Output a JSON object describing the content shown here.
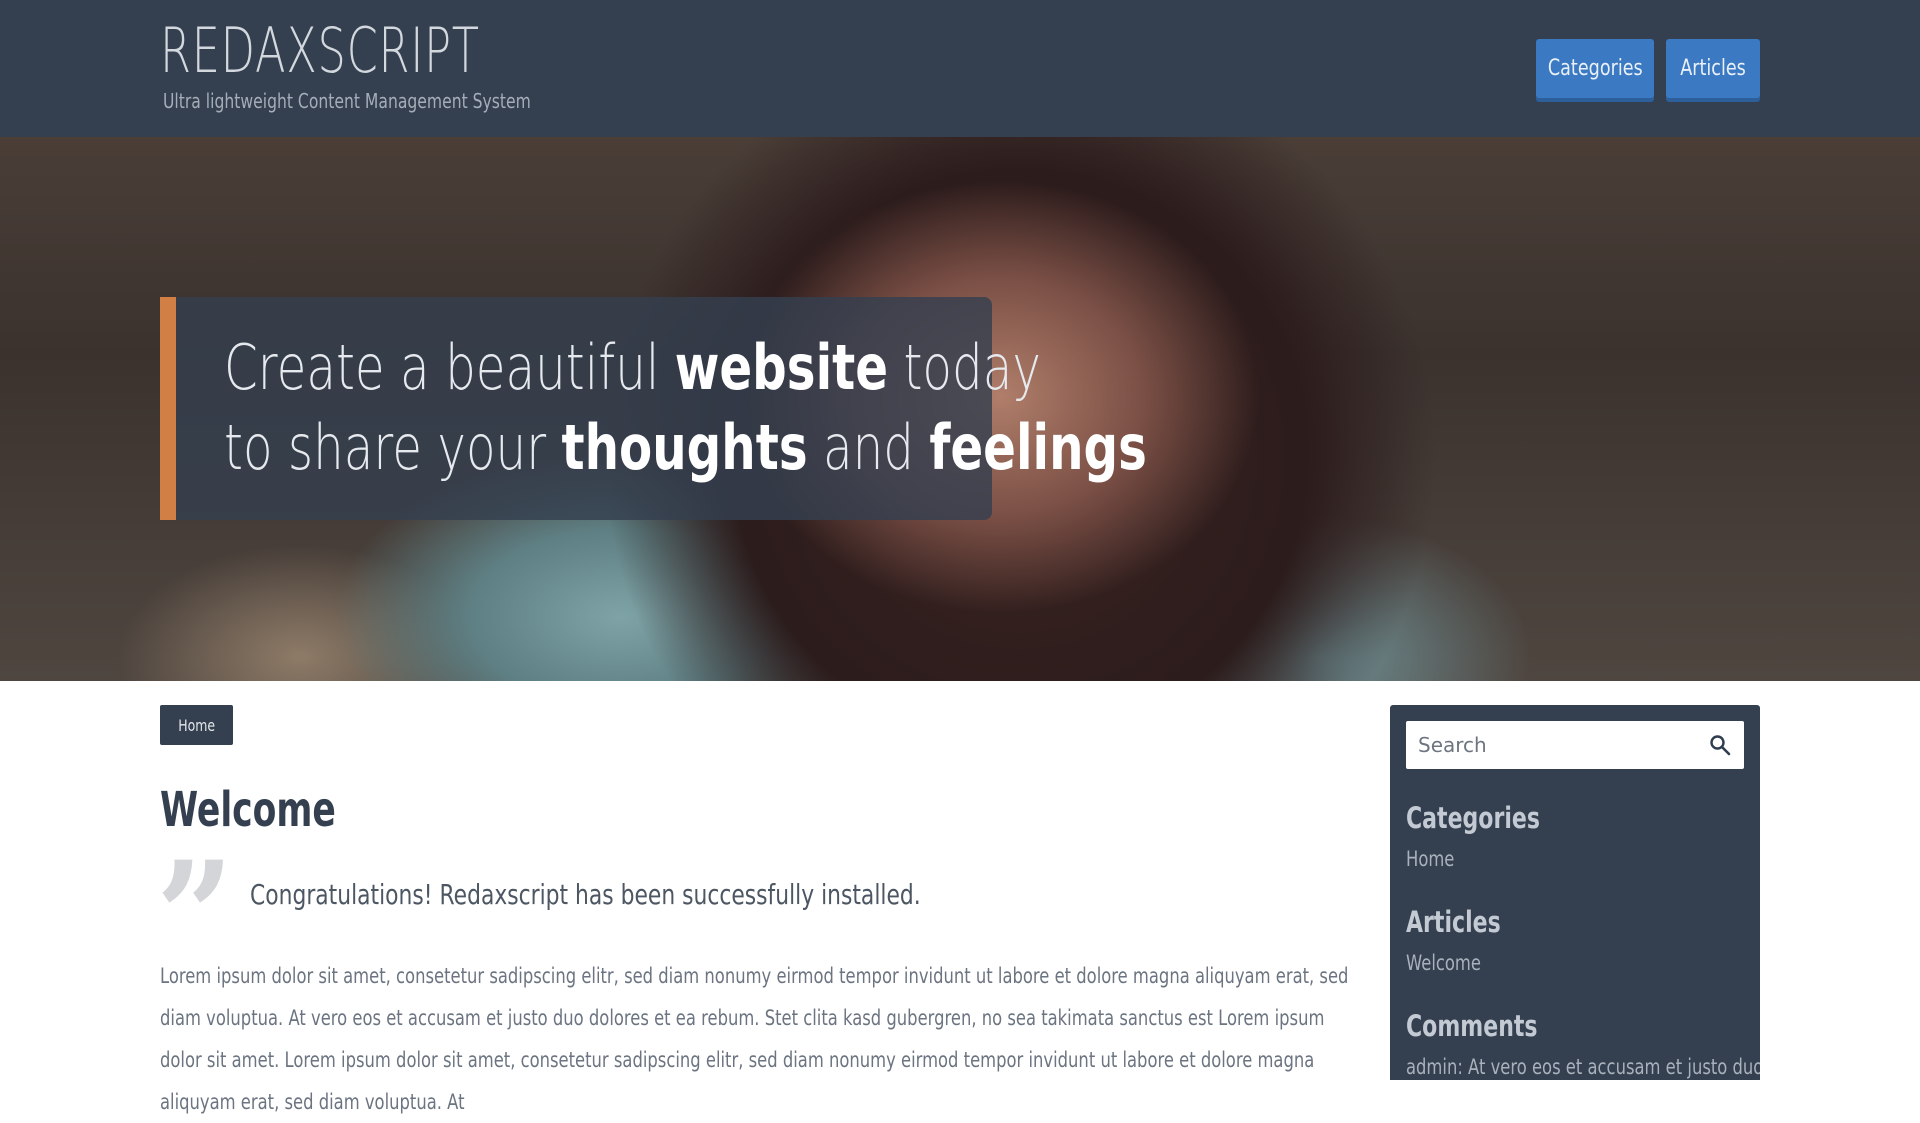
{
  "header": {
    "title": "REDAXSCRIPT",
    "tagline": "Ultra lightweight Content Management System",
    "nav": [
      {
        "label": "Categories"
      },
      {
        "label": "Articles"
      }
    ],
    "colors": {
      "background": "#34404f",
      "nav_button": "#3b79c2"
    }
  },
  "hero": {
    "line1": {
      "pre": "Create a beautiful ",
      "bold": "website",
      "post": " today"
    },
    "line2": {
      "pre": "to share your ",
      "bold1": "thoughts",
      "mid": " and ",
      "bold2": "feelings"
    },
    "accent_color": "#d17f44"
  },
  "breadcrumb": {
    "label": "Home"
  },
  "article": {
    "title": "Welcome",
    "lead": "Congratulations! Redaxscript has been successfully installed.",
    "body": "Lorem ipsum dolor sit amet, consetetur sadipscing elitr, sed diam nonumy eirmod tempor invidunt ut labore et dolore magna aliquyam erat, sed diam voluptua. At vero eos et accusam et justo duo dolores et ea rebum. Stet clita kasd gubergren, no sea takimata sanctus est Lorem ipsum dolor sit amet. Lorem ipsum dolor sit amet, consetetur sadipscing elitr, sed diam nonumy eirmod tempor invidunt ut labore et dolore magna aliquyam erat, sed diam voluptua. At"
  },
  "sidebar": {
    "search": {
      "placeholder": "Search",
      "icon": "search-icon"
    },
    "categories": {
      "heading": "Categories",
      "items": [
        "Home"
      ]
    },
    "articles": {
      "heading": "Articles",
      "items": [
        "Welcome"
      ]
    },
    "comments": {
      "heading": "Comments",
      "items": [
        "admin: At vero eos et accusam et justo duo."
      ]
    }
  }
}
